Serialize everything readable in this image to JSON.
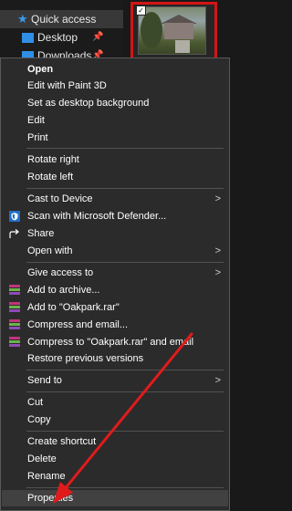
{
  "nav": {
    "quick_access": "Quick access",
    "desktop": "Desktop",
    "downloads": "Downloads"
  },
  "menu": {
    "items": {
      "open": "Open",
      "edit_paint3d": "Edit with Paint 3D",
      "set_desktop_bg": "Set as desktop background",
      "edit": "Edit",
      "print": "Print",
      "rotate_right": "Rotate right",
      "rotate_left": "Rotate left",
      "cast_to_device": "Cast to Device",
      "scan_defender": "Scan with Microsoft Defender...",
      "share": "Share",
      "open_with": "Open with",
      "give_access": "Give access to",
      "add_archive": "Add to archive...",
      "add_oakpark": "Add to \"Oakpark.rar\"",
      "compress_email": "Compress and email...",
      "compress_oakpark_email": "Compress to \"Oakpark.rar\" and email",
      "restore_versions": "Restore previous versions",
      "send_to": "Send to",
      "cut": "Cut",
      "copy": "Copy",
      "create_shortcut": "Create shortcut",
      "delete": "Delete",
      "rename": "Rename",
      "properties": "Properties"
    }
  },
  "colors": {
    "menu_bg": "#2b2b2b",
    "highlight_border": "#d41515",
    "annotation_arrow": "#e01b1b",
    "accent_blue": "#2b8fe0"
  }
}
